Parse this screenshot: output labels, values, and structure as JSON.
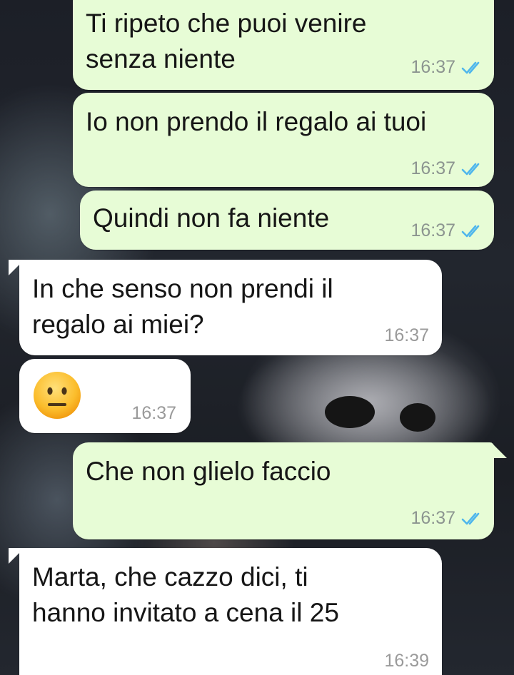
{
  "chat": {
    "messages": [
      {
        "id": "m1",
        "direction": "outgoing",
        "text": "Ti ripeto che puoi venire\nsenza niente",
        "time": "16:37",
        "status": "read-double-check-icon"
      },
      {
        "id": "m2",
        "direction": "outgoing",
        "text": "Io non prendo il regalo ai tuoi",
        "time": "16:37",
        "status": "read-double-check-icon"
      },
      {
        "id": "m3",
        "direction": "outgoing",
        "text": "Quindi non fa niente",
        "time": "16:37",
        "status": "read-double-check-icon"
      },
      {
        "id": "m4",
        "direction": "incoming",
        "text": "In che senso non prendi il\nregalo ai miei?",
        "time": "16:37"
      },
      {
        "id": "m5",
        "direction": "incoming",
        "emoji": "neutral-face-emoji",
        "time": "16:37"
      },
      {
        "id": "m6",
        "direction": "outgoing",
        "text": "Che non glielo faccio",
        "time": "16:37",
        "status": "read-double-check-icon"
      },
      {
        "id": "m7",
        "direction": "incoming",
        "text": "Marta, che cazzo dici, ti\nhanno invitato a cena il 25",
        "time": "16:39"
      }
    ]
  },
  "colors": {
    "outgoing_bubble": "#e7fcd6",
    "incoming_bubble": "#ffffff",
    "read_tick": "#4fb6ec"
  }
}
